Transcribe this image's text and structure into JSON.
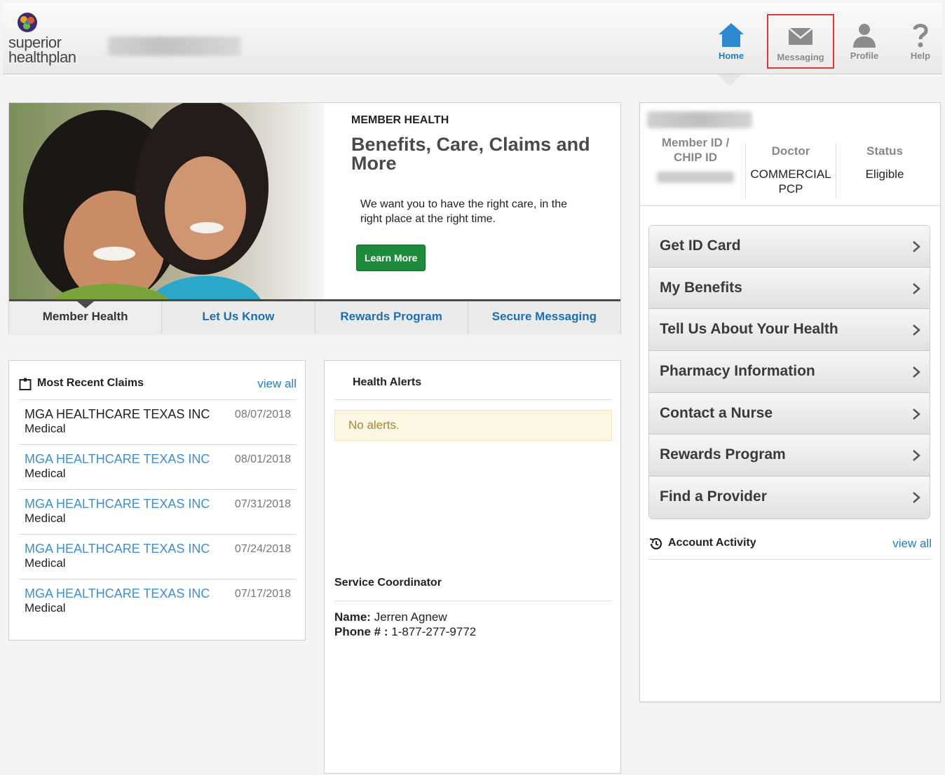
{
  "header": {
    "logo_line1": "superior",
    "logo_line2": "healthplan",
    "nav": [
      {
        "label": "Home",
        "icon": "home-icon",
        "active": true
      },
      {
        "label": "Messaging",
        "icon": "envelope-icon",
        "highlighted": true
      },
      {
        "label": "Profile",
        "icon": "person-icon"
      },
      {
        "label": "Help",
        "icon": "question-icon"
      }
    ]
  },
  "hero": {
    "kicker": "MEMBER HEALTH",
    "title": "Benefits, Care, Claims and More",
    "description": "We want you to have the right care, in the right place at the right time.",
    "button": "Learn More",
    "tabs": [
      "Member Health",
      "Let Us Know",
      "Rewards Program",
      "Secure Messaging"
    ]
  },
  "claims": {
    "title": "Most Recent Claims",
    "view_all": "view all",
    "rows": [
      {
        "provider": "MGA HEALTHCARE TEXAS INC",
        "type": "Medical",
        "date": "08/07/2018"
      },
      {
        "provider": "MGA HEALTHCARE TEXAS INC",
        "type": "Medical",
        "date": "08/01/2018"
      },
      {
        "provider": "MGA HEALTHCARE TEXAS INC",
        "type": "Medical",
        "date": "07/31/2018"
      },
      {
        "provider": "MGA HEALTHCARE TEXAS INC",
        "type": "Medical",
        "date": "07/24/2018"
      },
      {
        "provider": "MGA HEALTHCARE TEXAS INC",
        "type": "Medical",
        "date": "07/17/2018"
      }
    ]
  },
  "alerts": {
    "title": "Health Alerts",
    "empty_text": "No alerts.",
    "coordinator_title": "Service Coordinator",
    "name_label": "Name:",
    "name_value": "Jerren Agnew",
    "phone_label": "Phone # :",
    "phone_value": "1-877-277-9772"
  },
  "member": {
    "id_header": "Member ID / CHIP ID",
    "doctor_header": "Doctor",
    "doctor_value": "COMMERCIAL PCP",
    "status_header": "Status",
    "status_value": "Eligible",
    "menu": [
      "Get ID Card",
      "My Benefits",
      "Tell Us About Your Health",
      "Pharmacy Information",
      "Contact a Nurse",
      "Rewards Program",
      "Find a Provider"
    ],
    "activity_title": "Account Activity",
    "activity_view_all": "view all"
  },
  "colors": {
    "link": "#1d7fc4",
    "button_green": "#1e8a3c",
    "highlight_red": "#d43a3a",
    "alert_text": "#a9852e"
  }
}
